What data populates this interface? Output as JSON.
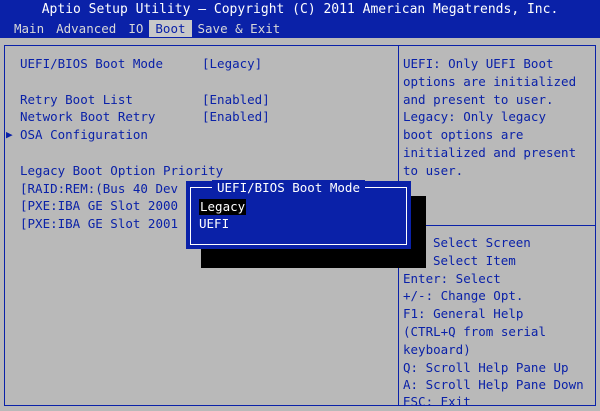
{
  "header": {
    "title": "Aptio Setup Utility – Copyright (C) 2011 American Megatrends, Inc.",
    "tabs": [
      {
        "label": "Main",
        "active": false
      },
      {
        "label": "Advanced",
        "active": false
      },
      {
        "label": "IO",
        "active": false
      },
      {
        "label": "Boot",
        "active": true
      },
      {
        "label": "Save & Exit",
        "active": false
      }
    ]
  },
  "settings": {
    "boot_mode_label": "UEFI/BIOS Boot Mode",
    "boot_mode_value": "[Legacy]",
    "retry_label": "Retry Boot List",
    "retry_value": "[Enabled]",
    "network_retry_label": "Network Boot Retry",
    "network_retry_value": "[Enabled]",
    "osa_label": "OSA Configuration",
    "legacy_priority_label": "Legacy Boot Option Priority",
    "boot_options": [
      "[RAID:REM:(Bus 40 Dev",
      "[PXE:IBA GE Slot 2000",
      "[PXE:IBA GE Slot 2001"
    ]
  },
  "help": {
    "description": [
      "UEFI: Only UEFI Boot",
      "options are initialized",
      "and present to user.",
      "Legacy: Only legacy",
      "boot options are",
      "initialized and present",
      "to user."
    ],
    "keys": [
      "Select Screen",
      "Select Item",
      "Enter: Select",
      "+/-: Change Opt.",
      "F1: General Help",
      "(CTRL+Q from serial",
      "keyboard)",
      "Q: Scroll Help Pane Up",
      "A: Scroll Help Pane Down",
      "ESC: Exit"
    ]
  },
  "popup": {
    "title": "UEFI/BIOS Boot Mode",
    "options": [
      "Legacy",
      "UEFI"
    ],
    "selected": "Legacy"
  },
  "colors": {
    "accent": "#0a21a8",
    "background": "#b9b9b9",
    "text_light": "#ffffff"
  }
}
